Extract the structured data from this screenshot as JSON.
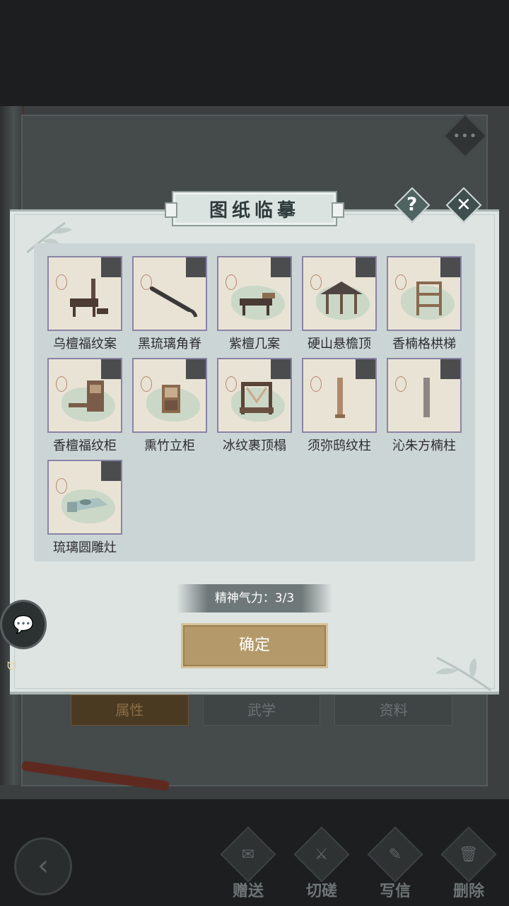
{
  "background": {
    "tabs": [
      "属性",
      "武学",
      "资料"
    ],
    "more_label": "•••",
    "actions": [
      {
        "label": "赠送",
        "icon": "scroll-icon"
      },
      {
        "label": "切磋",
        "icon": "sword-icon"
      },
      {
        "label": "写信",
        "icon": "letter-icon"
      },
      {
        "label": "删除",
        "icon": "trash-icon"
      }
    ]
  },
  "dialog": {
    "title": "图纸临摹",
    "help_label": "?",
    "close_label": "✕",
    "items": [
      {
        "name": "乌檀福纹案"
      },
      {
        "name": "黑琉璃角脊"
      },
      {
        "name": "紫檀几案"
      },
      {
        "name": "硬山悬檐顶"
      },
      {
        "name": "香楠格栱梯"
      },
      {
        "name": "香檀福纹柜"
      },
      {
        "name": "熏竹立柜"
      },
      {
        "name": "冰纹裹顶榻"
      },
      {
        "name": "须弥鸱纹柱"
      },
      {
        "name": "沁朱方楠柱"
      },
      {
        "name": "琉璃圆雕灶"
      }
    ],
    "spirit_label": "精神气力：3/3",
    "confirm_label": "确定"
  },
  "colors": {
    "dialog_bg": "#dde4e2",
    "grid_bg": "#ccd5d5",
    "card_border": "#8a84a6",
    "confirm_bg": "#b49a6b"
  }
}
